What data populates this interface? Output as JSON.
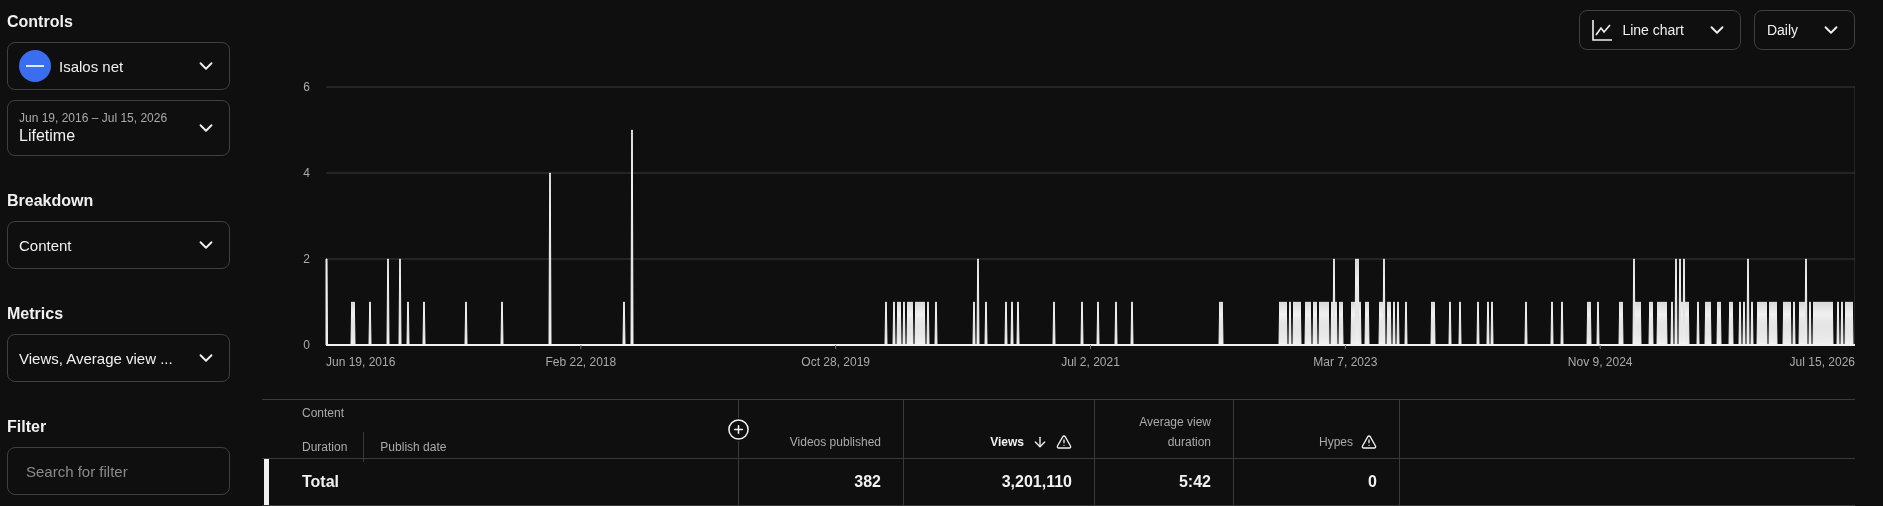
{
  "sidebar": [
    {
      "kind": "controls",
      "heading": "Controls",
      "channel": "Isalos net",
      "date_range": "Jun 19, 2016 – Jul 15, 2026",
      "period": "Lifetime"
    },
    {
      "kind": "select",
      "heading": "Breakdown",
      "value": "Content"
    },
    {
      "kind": "select",
      "heading": "Metrics",
      "value": "Views, Average view ..."
    },
    {
      "kind": "search",
      "heading": "Filter",
      "placeholder": "Search for filter"
    }
  ],
  "chart_toolbar": {
    "chart_type": "Line chart",
    "interval": "Daily"
  },
  "chart": {
    "y_ticks": [
      "6",
      "4",
      "2",
      "0"
    ],
    "x_ticks": [
      "Jun 19, 2016",
      "Feb 22, 2018",
      "Oct 28, 2019",
      "Jul 2, 2021",
      "Mar 7, 2023",
      "Nov 9, 2024",
      "Jul 15, 2026"
    ]
  },
  "table": {
    "dimension": {
      "label": "Content",
      "subcolumns": [
        "Duration",
        "Publish date"
      ]
    },
    "columns": [
      {
        "label": "Videos published",
        "sorted": false,
        "warning": false
      },
      {
        "label": "Views",
        "sorted": true,
        "warning": true
      },
      {
        "label": "Average view duration",
        "sorted": false,
        "warning": false
      },
      {
        "label": "Hypes",
        "sorted": false,
        "warning": true
      }
    ],
    "total_row": {
      "label": "Total",
      "values": [
        "382",
        "3,201,110",
        "5:42",
        "0"
      ]
    }
  }
}
